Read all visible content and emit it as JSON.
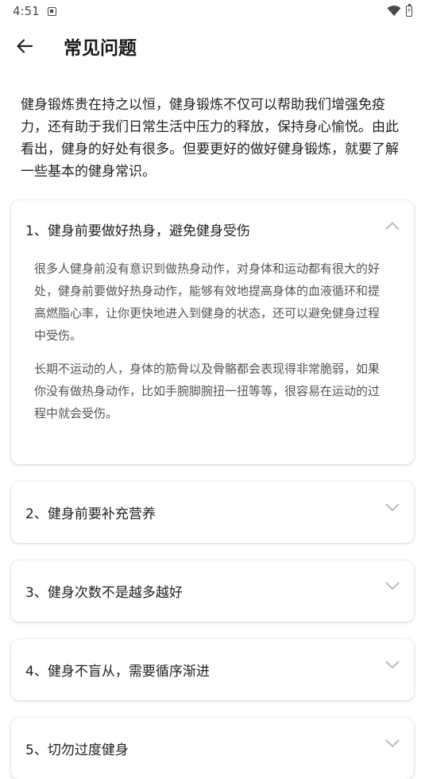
{
  "status_bar": {
    "time": "4:51",
    "icons": [
      "notification-icon",
      "wifi-icon",
      "battery-charging-icon"
    ]
  },
  "app_bar": {
    "back_icon": "back-arrow-icon",
    "title": "常见问题"
  },
  "intro": "健身锻炼贵在持之以恒，健身锻炼不仅可以帮助我们增强免疫力，还有助于我们日常生活中压力的释放，保持身心愉悦。由此看出，健身的好处有很多。但要更好的做好健身锻炼，就要了解一些基本的健身常识。",
  "faq": [
    {
      "title": "1、健身前要做好热身，避免健身受伤",
      "expanded": true,
      "paragraphs": [
        "很多人健身前没有意识到做热身动作，对身体和运动都有很大的好处，健身前要做好热身动作，能够有效地提高身体的血液循环和提高燃脂心率，让你更快地进入到健身的状态，还可以避免健身过程中受伤。",
        "长期不运动的人，身体的筋骨以及骨骼都会表现得非常脆弱，如果你没有做热身动作，比如手腕脚腕扭一扭等等，很容易在运动的过程中就会受伤。"
      ]
    },
    {
      "title": "2、健身前要补充营养",
      "expanded": false
    },
    {
      "title": "3、健身次数不是越多越好",
      "expanded": false
    },
    {
      "title": "4、健身不盲从，需要循序渐进",
      "expanded": false
    },
    {
      "title": "5、切勿过度健身",
      "expanded": false
    }
  ],
  "colors": {
    "chevron": "#bdbdbd",
    "body_text": "#555555",
    "title_text": "#1a1a1a"
  }
}
